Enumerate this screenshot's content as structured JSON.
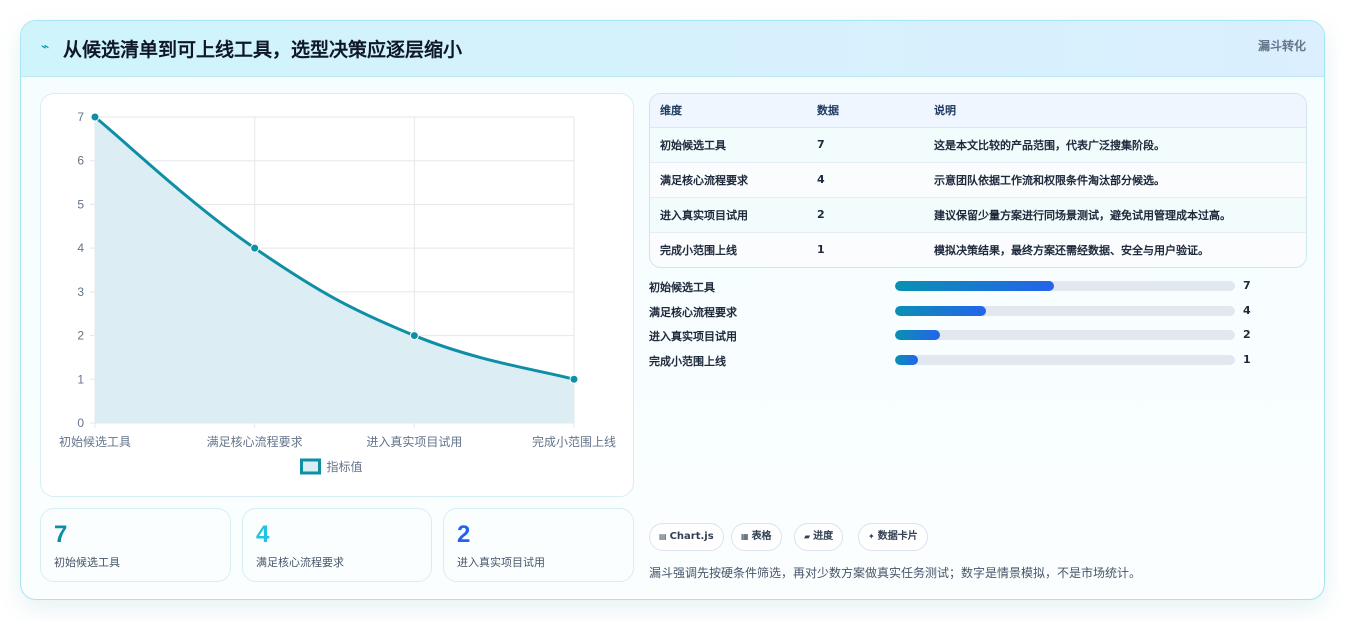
{
  "header": {
    "title": "从候选清单到可上线工具，选型决策应逐层缩小",
    "tag": "漏斗转化",
    "icon": "lightning-icon"
  },
  "chart_data": {
    "type": "area",
    "categories": [
      "初始候选工具",
      "满足核心流程要求",
      "进入真实项目试用",
      "完成小范围上线"
    ],
    "series": [
      {
        "name": "指标值",
        "values": [
          7,
          4,
          2,
          1
        ]
      }
    ],
    "ylim": [
      0,
      7
    ],
    "yticks": [
      "0",
      "1",
      "2",
      "3",
      "4",
      "5",
      "6",
      "7"
    ],
    "grid": true,
    "legend": "bottom",
    "line_color": "#0e8fa6",
    "fill_color": "#daedf3"
  },
  "stats": [
    {
      "value": "7",
      "label": "初始候选工具",
      "color": "#0e8fa6"
    },
    {
      "value": "4",
      "label": "满足核心流程要求",
      "color": "#22c3e0"
    },
    {
      "value": "2",
      "label": "进入真实项目试用",
      "color": "#2563eb"
    }
  ],
  "table": {
    "headers": [
      "维度",
      "数据",
      "说明"
    ],
    "rows": [
      {
        "dim": "初始候选工具",
        "value": "7",
        "desc": "这是本文比较的产品范围，代表广泛搜集阶段。"
      },
      {
        "dim": "满足核心流程要求",
        "value": "4",
        "desc": "示意团队依据工作流和权限条件淘汰部分候选。"
      },
      {
        "dim": "进入真实项目试用",
        "value": "2",
        "desc": "建议保留少量方案进行同场景测试，避免试用管理成本过高。"
      },
      {
        "dim": "完成小范围上线",
        "value": "1",
        "desc": "模拟决策结果，最终方案还需经数据、安全与用户验证。"
      }
    ]
  },
  "progress": {
    "max": 15,
    "items": [
      {
        "label": "初始候选工具",
        "value": 7
      },
      {
        "label": "满足核心流程要求",
        "value": 4
      },
      {
        "label": "进入真实项目试用",
        "value": 2
      },
      {
        "label": "完成小范围上线",
        "value": 1
      }
    ]
  },
  "chips": [
    {
      "icon": "▤",
      "label": "Chart.js"
    },
    {
      "icon": "▦",
      "label": "表格"
    },
    {
      "icon": "▰",
      "label": "进度"
    },
    {
      "icon": "✦",
      "label": "数据卡片"
    }
  ],
  "note": "漏斗强调先按硬条件筛选，再对少数方案做真实任务测试；数字是情景模拟，不是市场统计。"
}
